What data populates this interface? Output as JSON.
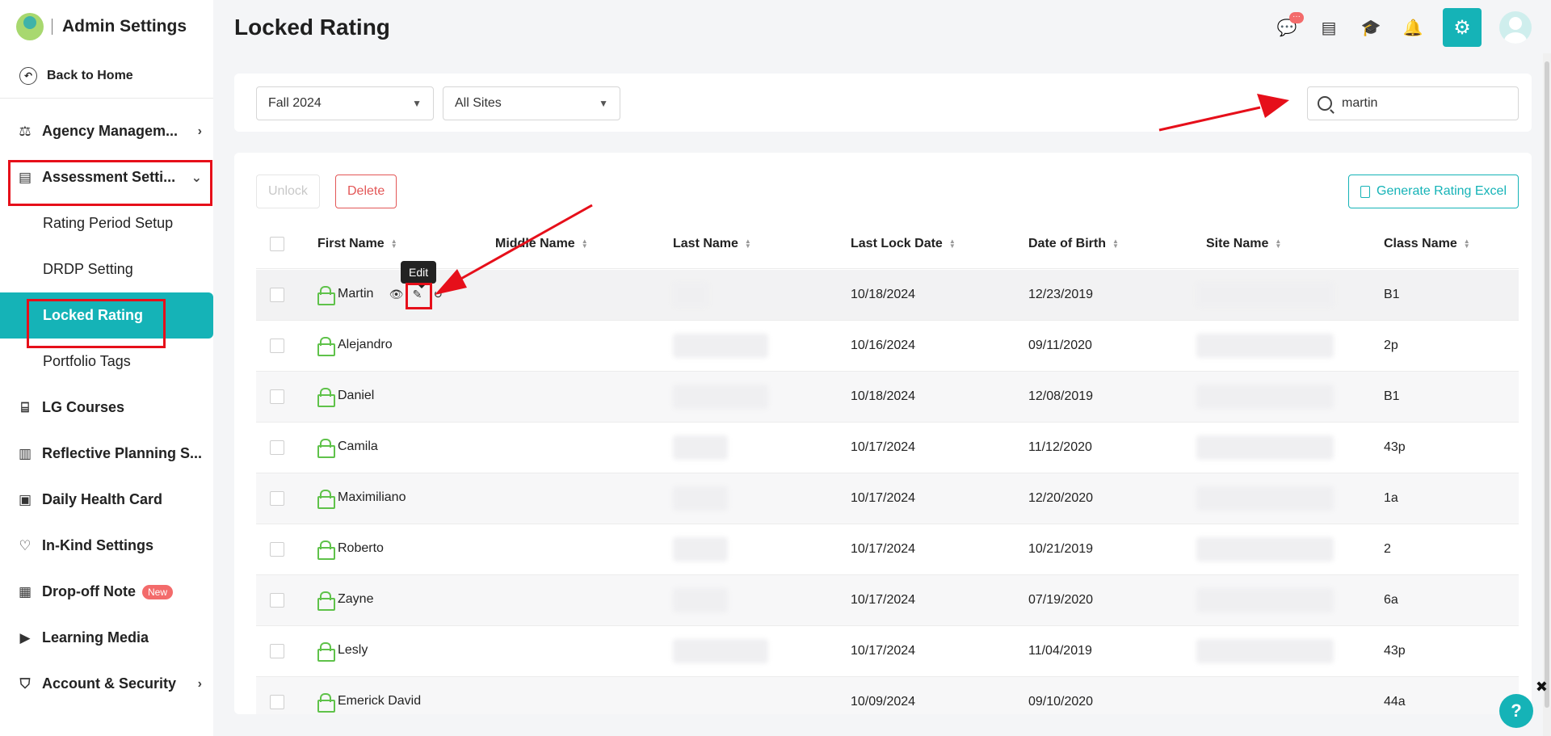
{
  "sidebar": {
    "title": "Admin Settings",
    "back": "Back to Home",
    "items": [
      {
        "label": "Agency Managem...",
        "icon": "hierarchy-icon",
        "chevron": "›"
      },
      {
        "label": "Assessment Setti...",
        "icon": "assessment-icon",
        "chevron": "⌄"
      },
      {
        "label": "Rating Period Setup"
      },
      {
        "label": "DRDP Setting"
      },
      {
        "label": "Locked Rating"
      },
      {
        "label": "Portfolio Tags"
      },
      {
        "label": "LG Courses",
        "icon": "presentation-icon"
      },
      {
        "label": "Reflective Planning S...",
        "icon": "book-icon"
      },
      {
        "label": "Daily Health Card",
        "icon": "health-card-icon"
      },
      {
        "label": "In-Kind Settings",
        "icon": "hand-heart-icon"
      },
      {
        "label": "Drop-off Note",
        "icon": "note-icon",
        "badge": "New"
      },
      {
        "label": "Learning Media",
        "icon": "play-icon"
      },
      {
        "label": "Account & Security",
        "icon": "shield-icon",
        "chevron": "›"
      }
    ]
  },
  "header": {
    "title": "Locked Rating",
    "chat_badge": "···"
  },
  "filters": {
    "period": "Fall 2024",
    "site": "All Sites",
    "search_value": "martin"
  },
  "toolbar": {
    "unlock": "Unlock",
    "delete": "Delete",
    "excel": "Generate Rating Excel"
  },
  "tooltip": "Edit",
  "table": {
    "columns": [
      "First Name",
      "Middle Name",
      "Last Name",
      "Last Lock Date",
      "Date of Birth",
      "Site Name",
      "Class Name"
    ],
    "rows": [
      {
        "first": "Martin",
        "lock_date": "10/18/2024",
        "dob": "12/23/2019",
        "class": "B1"
      },
      {
        "first": "Alejandro",
        "lock_date": "10/16/2024",
        "dob": "09/11/2020",
        "class": "2p"
      },
      {
        "first": "Daniel",
        "lock_date": "10/18/2024",
        "dob": "12/08/2019",
        "class": "B1"
      },
      {
        "first": "Camila",
        "lock_date": "10/17/2024",
        "dob": "11/12/2020",
        "class": "43p"
      },
      {
        "first": "Maximiliano",
        "lock_date": "10/17/2024",
        "dob": "12/20/2020",
        "class": "1a"
      },
      {
        "first": "Roberto",
        "lock_date": "10/17/2024",
        "dob": "10/21/2019",
        "class": "2"
      },
      {
        "first": "Zayne",
        "lock_date": "10/17/2024",
        "dob": "07/19/2020",
        "class": "6a"
      },
      {
        "first": "Lesly",
        "lock_date": "10/17/2024",
        "dob": "11/04/2019",
        "class": "43p"
      },
      {
        "first": "Emerick David",
        "lock_date": "10/09/2024",
        "dob": "09/10/2020",
        "class": "44a"
      }
    ]
  },
  "help": "?",
  "close": "✖",
  "colors": {
    "accent": "#15b3b7",
    "danger": "#e35757",
    "lock": "#5fc24a",
    "annotation": "#e60f1a"
  }
}
